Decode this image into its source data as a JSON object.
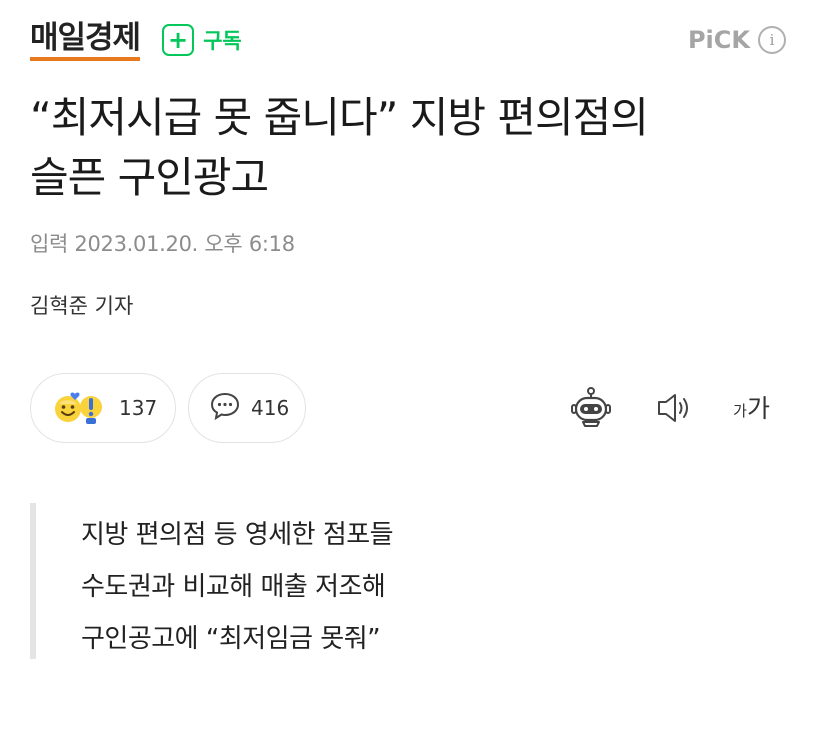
{
  "header": {
    "logo": "매일경제",
    "subscribe_label": "구독",
    "pick_label": "PiCK"
  },
  "article": {
    "headline_line1": "“최저시급 못 줍니다” 지방 편의점의",
    "headline_line2": "슬픈 구인광고",
    "date": "입력 2023.01.20. 오후 6:18",
    "reporter": "김혁준 기자"
  },
  "reactions": {
    "count": "137",
    "comments": "416"
  },
  "tools": {
    "font_small": "가",
    "font_large": "가"
  },
  "summary": {
    "lines": [
      "지방 편의점 등 영세한 점포들",
      "수도권과 비교해 매출 저조해",
      "구인공고에 “최저임금 못줘”"
    ]
  },
  "colors": {
    "accent_green": "#03c75a",
    "logo_underline": "#e8791e"
  }
}
